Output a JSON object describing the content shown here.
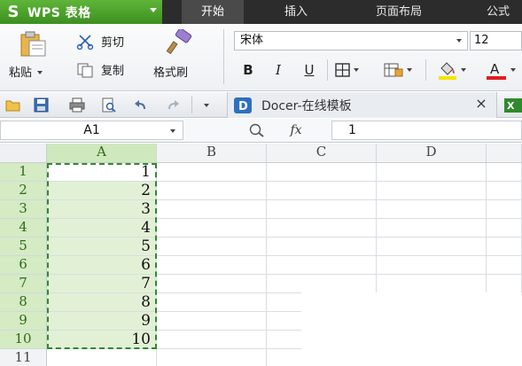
{
  "app": {
    "logo": "S",
    "title": "WPS 表格"
  },
  "tabs": [
    {
      "label": "开始",
      "active": true
    },
    {
      "label": "插入",
      "active": false
    },
    {
      "label": "页面布局",
      "active": false
    },
    {
      "label": "公式",
      "active": false
    }
  ],
  "ribbon": {
    "paste": "粘贴",
    "cut": "剪切",
    "copy": "复制",
    "format_painter": "格式刷",
    "font_name": "宋体",
    "font_size": "12",
    "bold": "B",
    "italic": "I",
    "underline": "U"
  },
  "doc_tab": {
    "label": "Docer-在线模板",
    "close": "×"
  },
  "formula_bar": {
    "name_box": "A1",
    "fx": "fx",
    "value": "1"
  },
  "columns": [
    "A",
    "B",
    "C",
    "D"
  ],
  "rows": [
    "1",
    "2",
    "3",
    "4",
    "5",
    "6",
    "7",
    "8",
    "9",
    "10",
    "11"
  ],
  "cells_a": [
    "1",
    "2",
    "3",
    "4",
    "5",
    "6",
    "7",
    "8",
    "9",
    "10",
    ""
  ],
  "colors": {
    "brand": "#3c8f1f",
    "selection": "#e2f1d6",
    "marquee": "#2f8a2c"
  }
}
